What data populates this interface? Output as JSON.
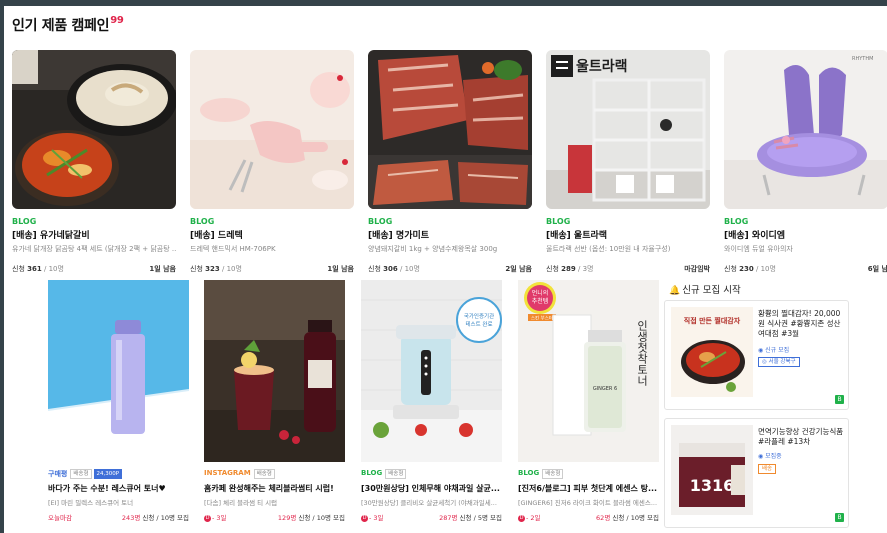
{
  "section": {
    "title": "인기 제품 캠페인",
    "hot_badge": "99"
  },
  "top_cards": [
    {
      "media": "BLOG",
      "title": "[배송] 유가네닭갈비",
      "desc": "유가네 닭개장 닭곰탕 4팩 세트 (닭개장 2팩 + 닭곰탕 ...",
      "applied": "361",
      "total": "10명",
      "apply_label": "신청",
      "days_left": "1일 남음"
    },
    {
      "media": "BLOG",
      "title": "[배송] 드레텍",
      "desc": "드레텍 핸드믹서 HM-706PK",
      "applied": "323",
      "total": "10명",
      "apply_label": "신청",
      "days_left": "1일 남음"
    },
    {
      "media": "BLOG",
      "title": "[배송] 명가미트",
      "desc": "양념돼지갈비 1kg + 양념수제왕목살 300g",
      "applied": "306",
      "total": "10명",
      "apply_label": "신청",
      "days_left": "2일 남음"
    },
    {
      "media": "BLOG",
      "title": "[배송] 울트라랙",
      "desc": "울트라랙 선반 (옵션: 10만원 내 자율구성)",
      "applied": "289",
      "total": "3명",
      "apply_label": "신청",
      "days_left": "마감임박"
    },
    {
      "media": "BLOG",
      "title": "[배송] 와이디엠",
      "desc": "와이디엠 듀얼 유아의자",
      "applied": "230",
      "total": "10명",
      "apply_label": "신청",
      "days_left": "6일 남"
    }
  ],
  "bottom_cards": [
    {
      "media": "구매평",
      "media_color": "#3f6fd8",
      "tag1": "배송형",
      "tag2": "24,300P",
      "title": "바다가 주는 수분! 레스큐어 토너♥",
      "desc": "[EI] 마린 밀렉스 레스큐어 토너",
      "left": "오늘마감",
      "applied": "243명",
      "total": "10명",
      "apply_label": "신청",
      "recruit_label": "모집"
    },
    {
      "media": "INSTAGRAM",
      "media_color": "#f08a2e",
      "tag1": "배송형",
      "tag2": "",
      "title": "홈카페 완성해주는 체리블라썸티 시럽!",
      "desc": "[다솜] 체리 블라썸 티 시럽",
      "left_badge": "D",
      "left": "- 3일",
      "applied": "129명",
      "total": "10명",
      "apply_label": "신청",
      "recruit_label": "모집"
    },
    {
      "media": "BLOG",
      "media_color": "#20b14a",
      "tag1": "배송형",
      "tag2": "",
      "title": "[30만원상당] 인체무해 야채과일 살균...",
      "desc": "[30만원상당] 클리비오 살균세척기 (야채과일세...",
      "left_badge": "D",
      "left": "- 3일",
      "applied": "287명",
      "total": "5명",
      "apply_label": "신청",
      "recruit_label": "모집"
    },
    {
      "media": "BLOG",
      "media_color": "#20b14a",
      "tag1": "배송형",
      "tag2": "",
      "title": "[진저6/블로그] 피부 첫단계 에센스 탕...",
      "desc": "[GINGER6] 진저6 라이크 화이트 블라썸 에센스...",
      "left_badge": "D",
      "left": "- 2일",
      "applied": "62명",
      "total": "10명",
      "apply_label": "신청",
      "recruit_label": "모집"
    }
  ],
  "new_recruit": {
    "title": "신규 모집 시작",
    "items": [
      {
        "title": "황쁑의 찔대감자! 20,000원 식사권 #황쁑지존 성산여대점 #3월",
        "sub": "◉ 신규 모집",
        "loc": "◎ 서울 강북구",
        "badge": "B"
      },
      {
        "title": "면역기능향상 건강기능식품 #라플레 #13차",
        "sub": "◉ 모집중",
        "tag": "배송",
        "badge": "B"
      }
    ],
    "thumb1_text": "직접 만든 찔대감자",
    "thumb2_text": "1316"
  },
  "image_text": {
    "ultra_logo": "울트라랙",
    "ydm_logo": "RHYTHM",
    "toner_sticker_1": "국가인증기관",
    "toner_sticker_2": "테스트 완료",
    "essence_sticker_1": "언니의",
    "essence_sticker_2": "추천템",
    "essence_sticker_3": "스킨 부스터",
    "essence_vertical": "인생첫착토너",
    "essence_bottle": "GINGER 6"
  },
  "colors": {
    "accent_red": "#e0254b",
    "blog_green": "#20b14a",
    "blue": "#3f6fd8",
    "orange": "#f08a2e"
  }
}
